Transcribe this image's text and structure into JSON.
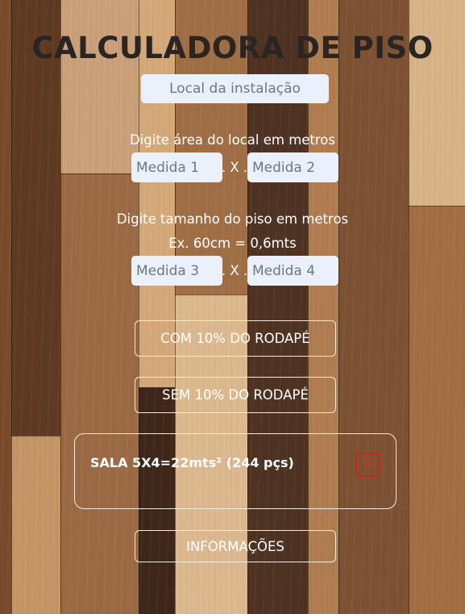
{
  "app": {
    "title": "CALCULADORA DE PISO"
  },
  "location": {
    "placeholder": "Local da instalação"
  },
  "area": {
    "label": "Digite área do local em metros",
    "measure1_placeholder": "Medida 1",
    "measure2_placeholder": "Medida 2",
    "separator": ". X ."
  },
  "tile": {
    "label": "Digite tamanho do piso em metros",
    "example": "Ex. 60cm = 0,6mts",
    "measure3_placeholder": "Medida 3",
    "measure4_placeholder": "Medida 4",
    "separator": ". X ."
  },
  "actions": {
    "with_baseboard": "COM 10% DO RODAPÉ",
    "without_baseboard": "SEM 10% DO RODAPÉ",
    "info": "INFORMAÇÕES"
  },
  "results": [
    {
      "text": "SALA 5X4=22mts² (244 pçs)",
      "remove_label": "X"
    }
  ],
  "colors": {
    "title": "#2a2522",
    "input_bg": "#e9f2fc",
    "text": "#ffffff",
    "remove": "#c8231d"
  }
}
